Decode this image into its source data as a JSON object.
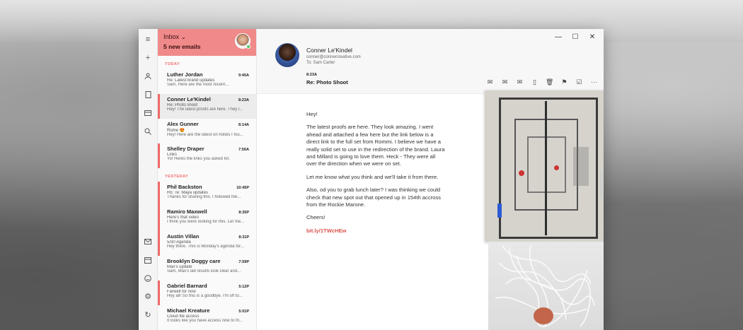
{
  "rail": {
    "icons_top": [
      "menu-icon",
      "plus-icon",
      "person-icon",
      "document-icon",
      "card-icon",
      "search-icon"
    ],
    "icons_bottom": [
      "mail-icon",
      "calendar-icon",
      "emoji-icon",
      "settings-icon",
      "refresh-icon"
    ]
  },
  "list": {
    "folder": "Inbox ⌄",
    "new_count": "5 new emails",
    "section_today": "TODAY",
    "section_yesterday": "YESTEDAY",
    "today": [
      {
        "name": "Luther Jordan",
        "time": "9:45A",
        "subject": "Re: Latest brand updates",
        "preview": "Sam, Here are the most recent..."
      },
      {
        "name": "Conner Le'Kindel",
        "time": "8:23A",
        "subject": "Re: Photo shoot",
        "preview": "Hey! The latest proofs are here. They l..."
      },
      {
        "name": "Alex Gunner",
        "time": "8:14A",
        "subject": "Rome 😍",
        "preview": "Hey! Here are the latest on hotels I fou..."
      },
      {
        "name": "Shelley Draper",
        "time": "7:56A",
        "subject": "Links",
        "preview": "Yo! Heres the links you asked for."
      }
    ],
    "yesterday": [
      {
        "name": "Phil Backston",
        "time": "10:45P",
        "subject": "RE: re: Maya updates",
        "preview": "Thanks for sharing this. I followed the..."
      },
      {
        "name": "Ramiro Maxwell",
        "time": "8:35P",
        "subject": "Here's that video",
        "preview": "I think you were looking for this. Let me..."
      },
      {
        "name": "Austin Villan",
        "time": "8:31P",
        "subject": "5/30 Agenda",
        "preview": "Hey there. This is Monday's agenda for..."
      },
      {
        "name": "Brooklyn Doggy care",
        "time": "7:59P",
        "subject": "Max's update",
        "preview": "Sam, Max's lab results look clear and..."
      },
      {
        "name": "Gabriel Barnard",
        "time": "5:12P",
        "subject": "Farwell for now",
        "preview": "Hey all! So this is a goodbye. I'm off to..."
      },
      {
        "name": "Michael Kreature",
        "time": "5:01P",
        "subject": "Cloud file access",
        "preview": "It looks like you have access now to th..."
      }
    ]
  },
  "reader": {
    "sender_name": "Conner Le'Kindel",
    "sender_email": "conner@connercreative.com",
    "to": "To: Sam Carter",
    "time": "8:23A",
    "subject": "Re: Photo Shoot",
    "window_controls": [
      "—",
      "☐",
      "✕"
    ],
    "tools": [
      "✉",
      "✉",
      "✉",
      "▯",
      "🗑",
      "⚑",
      "☑",
      "···"
    ],
    "body": [
      "Hey!",
      "The latest proofs are here. They look amazing. I went ahead and attached a few here but the link below is a direct link to the full set from Rommi. I believe we have a really solid set to use in the redirection of the brand. Laura and Millard is going to love them. Heck - They were all over the direction when we were on set.",
      "Let me know what you think and we'll take it from there.",
      "Also, od you to grab lunch later? I was thinking we could check that new spot out that opened up in 154th accross from the Rockie Marone.",
      "Cheers!"
    ],
    "link": "bit.ly/1TWcHEw"
  }
}
